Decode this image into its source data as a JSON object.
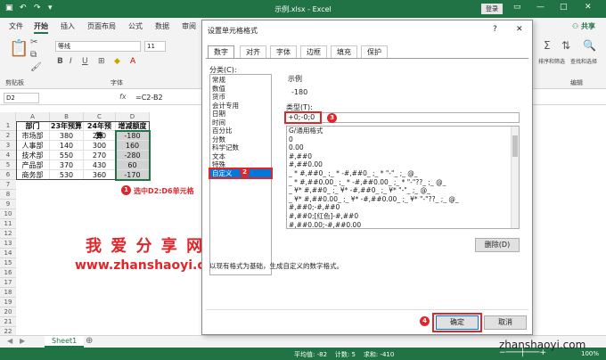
{
  "window": {
    "title": "示例.xlsx  -  Excel",
    "login_label": "登录",
    "minimize_icon": "—",
    "restore_icon": "□",
    "close_icon": "✕"
  },
  "ribbon": {
    "tabs": [
      "文件",
      "开始",
      "插入",
      "页面布局",
      "公式",
      "数据",
      "审阅"
    ],
    "active_tab": "开始",
    "share_label": "共享",
    "font_name": "等线",
    "font_size": "11",
    "clipboard_label": "剪贴板",
    "font_group_label": "字体",
    "edit_group_label": "编辑",
    "search_select_label": "查找和选择",
    "sort_filter_label": "排序和筛选",
    "bold": "B",
    "italic": "I",
    "underline": "U"
  },
  "formula_bar": {
    "name_box": "D2",
    "fx": "fx",
    "formula": "=C2-B2"
  },
  "sheet": {
    "columns": [
      "A",
      "B",
      "C",
      "D"
    ],
    "header": [
      "部门",
      "23年预算",
      "24年预算",
      "增减额度"
    ],
    "rows": [
      [
        "市场部",
        "380",
        "200",
        "-180"
      ],
      [
        "人事部",
        "140",
        "300",
        "160"
      ],
      [
        "技术部",
        "550",
        "270",
        "-280"
      ],
      [
        "产品部",
        "370",
        "430",
        "60"
      ],
      [
        "商务部",
        "530",
        "360",
        "-170"
      ]
    ],
    "row_numbers": [
      "1",
      "2",
      "3",
      "4",
      "5",
      "6",
      "7",
      "8",
      "9",
      "10",
      "11",
      "12",
      "13",
      "14",
      "15",
      "16",
      "17",
      "18",
      "19",
      "20",
      "21",
      "22"
    ],
    "annotation_step": "1",
    "annotation_text": "选中D2:D6单元格",
    "watermark_title": "我 爱 分 享 网",
    "watermark_url": "www.zhanshaoyi.com",
    "sheet_tab": "Sheet1",
    "status": "平均值: -82    计数: 5    求和: -410",
    "zoom": "100%",
    "corner_watermark": "zhanshaoyi.com"
  },
  "dialog": {
    "title": "设置单元格格式",
    "help_icon": "?",
    "close_icon": "✕",
    "tabs": [
      "数字",
      "对齐",
      "字体",
      "边框",
      "填充",
      "保护"
    ],
    "active_tab": "数字",
    "category_label": "分类(C):",
    "categories": [
      "常规",
      "数值",
      "货币",
      "会计专用",
      "日期",
      "时间",
      "百分比",
      "分数",
      "科学记数",
      "文本",
      "特殊",
      "自定义"
    ],
    "selected_category": "自定义",
    "sample_label": "示例",
    "sample_value": "-180",
    "type_label": "类型(T):",
    "type_value": "+0;-0;0",
    "formats": [
      "G/通用格式",
      "0",
      "0.00",
      "#,##0",
      "#,##0.00",
      "_ * #,##0_ ;_ * -#,##0_ ;_ * \"-\"_ ;_ @_",
      "_ * #,##0.00_ ;_ * -#,##0.00_ ;_ * \"-\"??_ ;_ @_",
      "_ ¥* #,##0_ ;_ ¥* -#,##0_ ;_ ¥* \"-\"_ ;_ @_",
      "_ ¥* #,##0.00_ ;_ ¥* -#,##0.00_ ;_ ¥* \"-\"??_ ;_ @_",
      "#,##0;-#,##0",
      "#,##0;[红色]-#,##0",
      "#,##0.00;-#,##0.00"
    ],
    "delete_label": "删除(D)",
    "description": "以现有格式为基础，生成自定义的数字格式。",
    "ok_label": "确定",
    "cancel_label": "取消",
    "step2": "2",
    "step3": "3",
    "step4": "4"
  },
  "colors": {
    "excel_green": "#217346",
    "annotation_red": "#e0262b",
    "selection_blue": "#0078d7"
  }
}
